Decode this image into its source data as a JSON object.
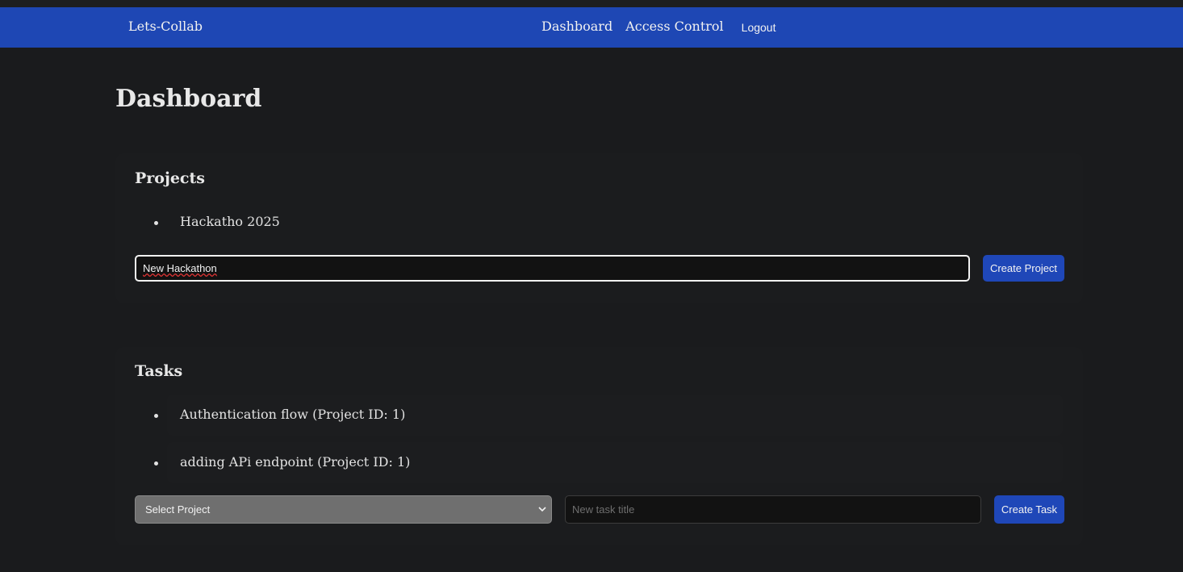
{
  "navbar": {
    "brand": "Lets-Collab",
    "links": [
      "Dashboard",
      "Access Control"
    ],
    "logout": "Logout"
  },
  "page": {
    "title": "Dashboard"
  },
  "projects": {
    "heading": "Projects",
    "items": [
      "Hackatho 2025"
    ],
    "input_value": "New Hackathon",
    "create_label": "Create Project"
  },
  "tasks": {
    "heading": "Tasks",
    "items": [
      "Authentication flow (Project ID: 1)",
      "adding APi endpoint (Project ID: 1)"
    ],
    "select_value": "Select Project",
    "input_placeholder": "New task title",
    "create_label": "Create Task"
  },
  "colors": {
    "navbar": "#1e47b4",
    "background": "#1a1b1d",
    "button": "#1f47b8"
  },
  "icons": {
    "select": "chevron-down-icon"
  }
}
